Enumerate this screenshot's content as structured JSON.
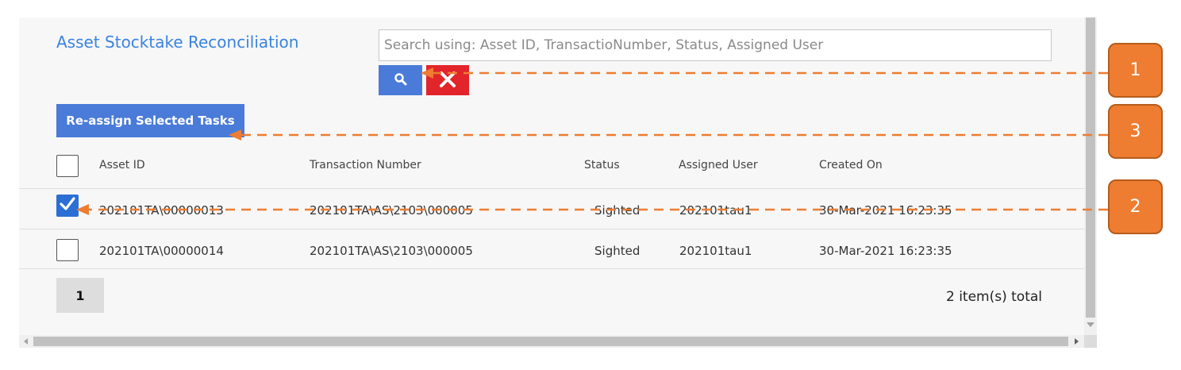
{
  "page": {
    "title": "Asset Stocktake Reconciliation",
    "search_placeholder": "Search using: Asset ID, TransactioNumber, Status, Assigned User",
    "search_button_icon": "search-icon",
    "clear_button_icon": "close-icon",
    "reassign_label": "Re-assign Selected Tasks"
  },
  "table": {
    "columns": [
      "Asset ID",
      "Transaction Number",
      "Status",
      "Assigned User",
      "Created On"
    ],
    "rows": [
      {
        "checked": true,
        "asset_id": "202101TA\\00000013",
        "transaction_number": "202101TA\\AS\\2103\\000005",
        "status": "Sighted",
        "assigned_user": "202101tau1",
        "created_on": "30-Mar-2021 16:23:35"
      },
      {
        "checked": false,
        "asset_id": "202101TA\\00000014",
        "transaction_number": "202101TA\\AS\\2103\\000005",
        "status": "Sighted",
        "assigned_user": "202101tau1",
        "created_on": "30-Mar-2021 16:23:35"
      }
    ]
  },
  "pager": {
    "current_page": "1",
    "total_text": "2 item(s) total"
  },
  "callouts": [
    "1",
    "3",
    "2"
  ],
  "colors": {
    "title": "#3a83e0",
    "primary_button": "#4a7bd8",
    "clear_button": "#e2242b",
    "checkbox_checked": "#2b6fd4",
    "callout": "#ee7d31"
  }
}
